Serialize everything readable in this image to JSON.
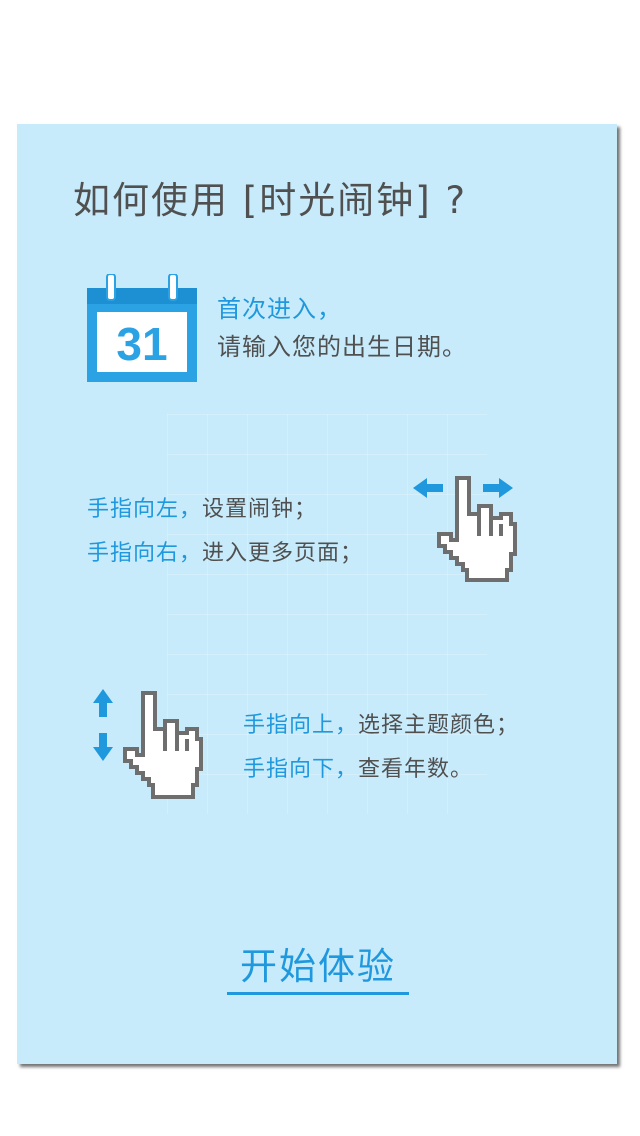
{
  "title": "如何使用 [时光闹钟] ?",
  "calendar_icon": {
    "day": "31"
  },
  "section_first_entry": {
    "line1": "首次进入，",
    "line2": "请输入您的出生日期。"
  },
  "section_horizontal": {
    "left_highlight": "手指向左，",
    "left_text": "设置闹钟；",
    "right_highlight": "手指向右，",
    "right_text": "进入更多页面；"
  },
  "section_vertical": {
    "up_highlight": "手指向上，",
    "up_text": "选择主题颜色；",
    "down_highlight": "手指向下，",
    "down_text": "查看年数。"
  },
  "start_button": "开始体验",
  "colors": {
    "background": "#c8ebfb",
    "accent": "#1f98dd",
    "text": "#505050",
    "hand_outline": "#6e6e6e"
  }
}
